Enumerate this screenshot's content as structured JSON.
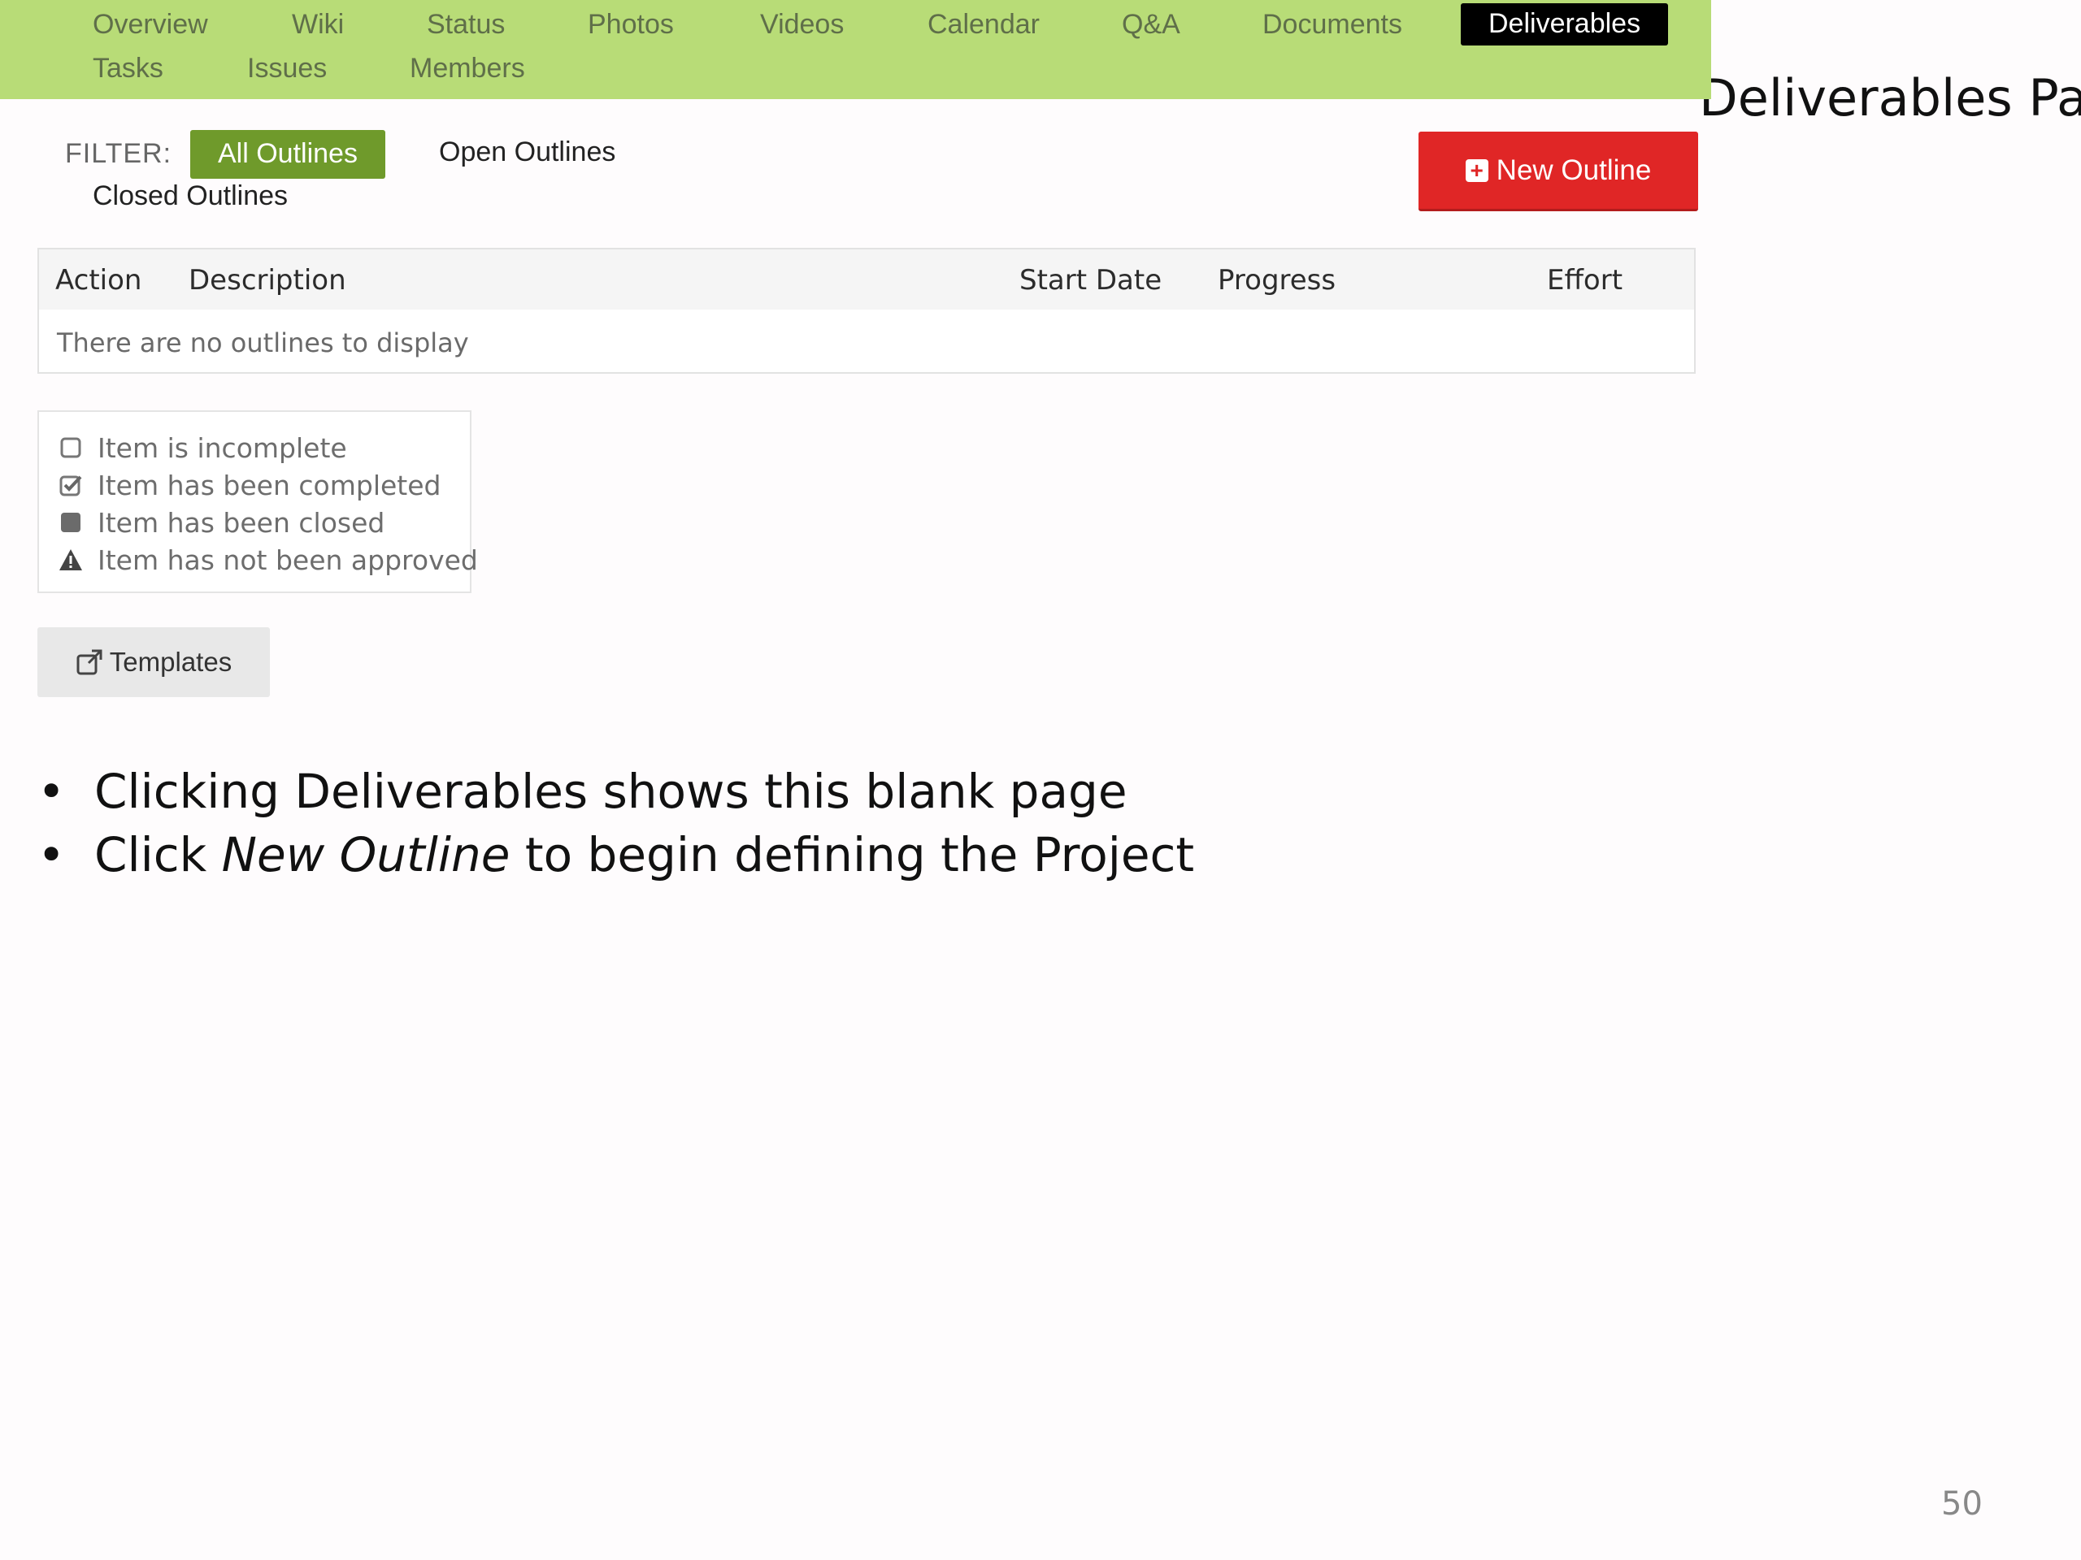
{
  "slide": {
    "title": "Deliverables Page",
    "page_number": "50",
    "bullets": [
      {
        "text": "Clicking Deliverables shows this blank page"
      },
      {
        "prefix": "Click ",
        "emphasis": "New Outline",
        "suffix": " to begin defining the Project"
      }
    ]
  },
  "nav": {
    "items": [
      "Overview",
      "Wiki",
      "Status",
      "Photos",
      "Videos",
      "Calendar",
      "Q&A",
      "Documents",
      "Deliverables",
      "Tasks",
      "Issues",
      "Members"
    ],
    "active": "Deliverables",
    "bar_color": "#b8dc77"
  },
  "filter": {
    "label": "FILTER:",
    "options": [
      "All Outlines",
      "Open Outlines",
      "Closed Outlines"
    ],
    "active": "All Outlines"
  },
  "new_outline_button": {
    "label": "New Outline",
    "icon": "plus-square-icon",
    "color": "#e02626"
  },
  "table": {
    "columns": [
      "Action",
      "Description",
      "Start Date",
      "Progress",
      "Effort"
    ],
    "empty_message": "There are no outlines to display"
  },
  "legend": [
    {
      "icon": "empty-checkbox-icon",
      "label": "Item is incomplete"
    },
    {
      "icon": "checked-checkbox-icon",
      "label": "Item has been completed"
    },
    {
      "icon": "filled-square-icon",
      "label": "Item has been closed"
    },
    {
      "icon": "warning-triangle-icon",
      "label": "Item has not been approved"
    }
  ],
  "templates_button": {
    "label": "Templates",
    "icon": "external-link-icon"
  }
}
